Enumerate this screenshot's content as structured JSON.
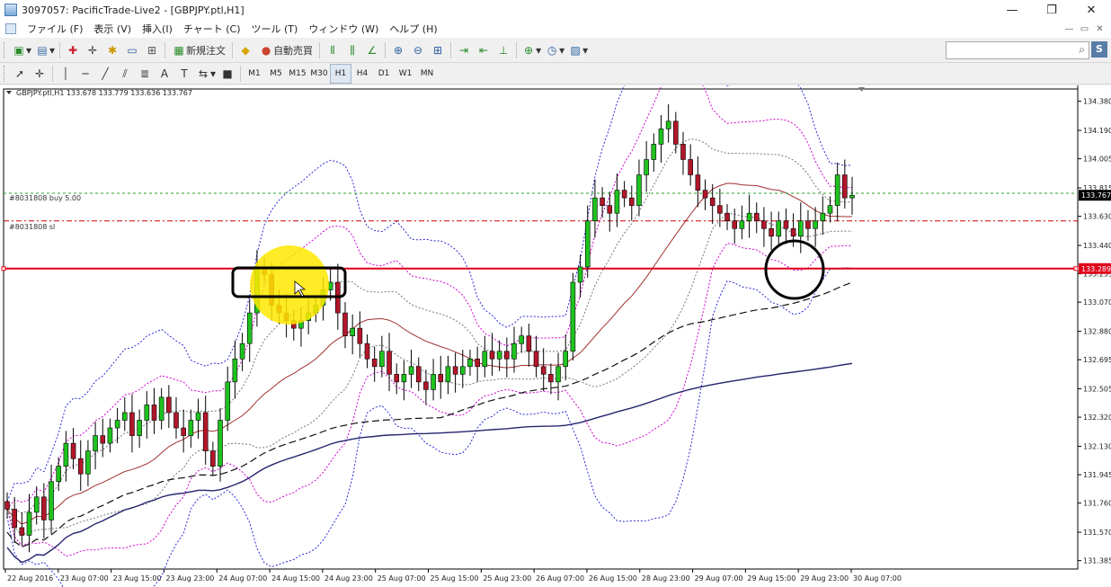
{
  "window": {
    "title": "3097057: PacificTrade-Live2 - [GBPJPY.ptl,H1]",
    "buttons": [
      "—",
      "❐",
      "✕"
    ]
  },
  "menu": {
    "items": [
      "ファイル (F)",
      "表示 (V)",
      "挿入(I)",
      "チャート (C)",
      "ツール (T)",
      "ウィンドウ (W)",
      "ヘルプ (H)"
    ],
    "mdi_buttons": [
      "—",
      "▭",
      "✕"
    ]
  },
  "toolbar": {
    "new_order": "新規注文",
    "auto_trade": "自動売買"
  },
  "timeframes": [
    "M1",
    "M5",
    "M15",
    "M30",
    "H1",
    "H4",
    "D1",
    "W1",
    "MN"
  ],
  "active_timeframe": "H1",
  "chart": {
    "symbol_header": "GBPJPY.ptl,H1  133.678 133.779 133.636 133.767",
    "buy_order_label": "#8031808 buy 5.00",
    "sl_label": "#8031808 sl",
    "current_price": "133.767",
    "line_price": "133.289"
  },
  "chart_data": {
    "type": "candlestick",
    "symbol": "GBPJPY.ptl",
    "timeframe": "H1",
    "price_axis_ticks": [
      "134.380",
      "134.190",
      "134.005",
      "133.815",
      "133.630",
      "133.440",
      "133.255",
      "133.070",
      "132.880",
      "132.695",
      "132.505",
      "132.320",
      "132.130",
      "131.945",
      "131.760",
      "131.570",
      "131.385"
    ],
    "time_axis_ticks": [
      "22 Aug 2016",
      "23 Aug 07:00",
      "23 Aug 15:00",
      "23 Aug 23:00",
      "24 Aug 07:00",
      "24 Aug 15:00",
      "24 Aug 23:00",
      "25 Aug 07:00",
      "25 Aug 15:00",
      "25 Aug 23:00",
      "26 Aug 07:00",
      "26 Aug 15:00",
      "28 Aug 23:00",
      "29 Aug 07:00",
      "29 Aug 15:00",
      "29 Aug 23:00",
      "30 Aug 07:00"
    ],
    "last_bar": {
      "open": 133.678,
      "high": 133.779,
      "low": 133.636,
      "close": 133.767
    },
    "horizontal_line": 133.289,
    "buy_order_price": 133.78,
    "stop_loss": 133.6,
    "closes": [
      131.72,
      131.6,
      131.55,
      131.7,
      131.8,
      131.65,
      131.9,
      132.0,
      132.15,
      132.05,
      131.95,
      132.1,
      132.2,
      132.15,
      132.25,
      132.3,
      132.35,
      132.2,
      132.3,
      132.4,
      132.3,
      132.45,
      132.35,
      132.25,
      132.2,
      132.3,
      132.35,
      132.1,
      132.0,
      132.3,
      132.55,
      132.7,
      132.8,
      133.0,
      133.3,
      133.25,
      133.05,
      133.0,
      132.95,
      132.9,
      132.95,
      133.0,
      133.05,
      133.15,
      133.2,
      133.0,
      132.85,
      132.9,
      132.8,
      132.7,
      132.65,
      132.75,
      132.6,
      132.55,
      132.6,
      132.65,
      132.55,
      132.5,
      132.6,
      132.55,
      132.65,
      132.6,
      132.65,
      132.7,
      132.65,
      132.75,
      132.7,
      132.75,
      132.7,
      132.8,
      132.85,
      132.75,
      132.65,
      132.6,
      132.55,
      132.65,
      132.75,
      133.2,
      133.3,
      133.6,
      133.75,
      133.7,
      133.65,
      133.8,
      133.75,
      133.7,
      133.9,
      134.0,
      134.1,
      134.2,
      134.25,
      134.1,
      134.0,
      133.9,
      133.8,
      133.75,
      133.7,
      133.65,
      133.6,
      133.55,
      133.6,
      133.65,
      133.6,
      133.55,
      133.5,
      133.6,
      133.55,
      133.5,
      133.6,
      133.55,
      133.6,
      133.65,
      133.7,
      133.9,
      133.75,
      133.767
    ]
  }
}
